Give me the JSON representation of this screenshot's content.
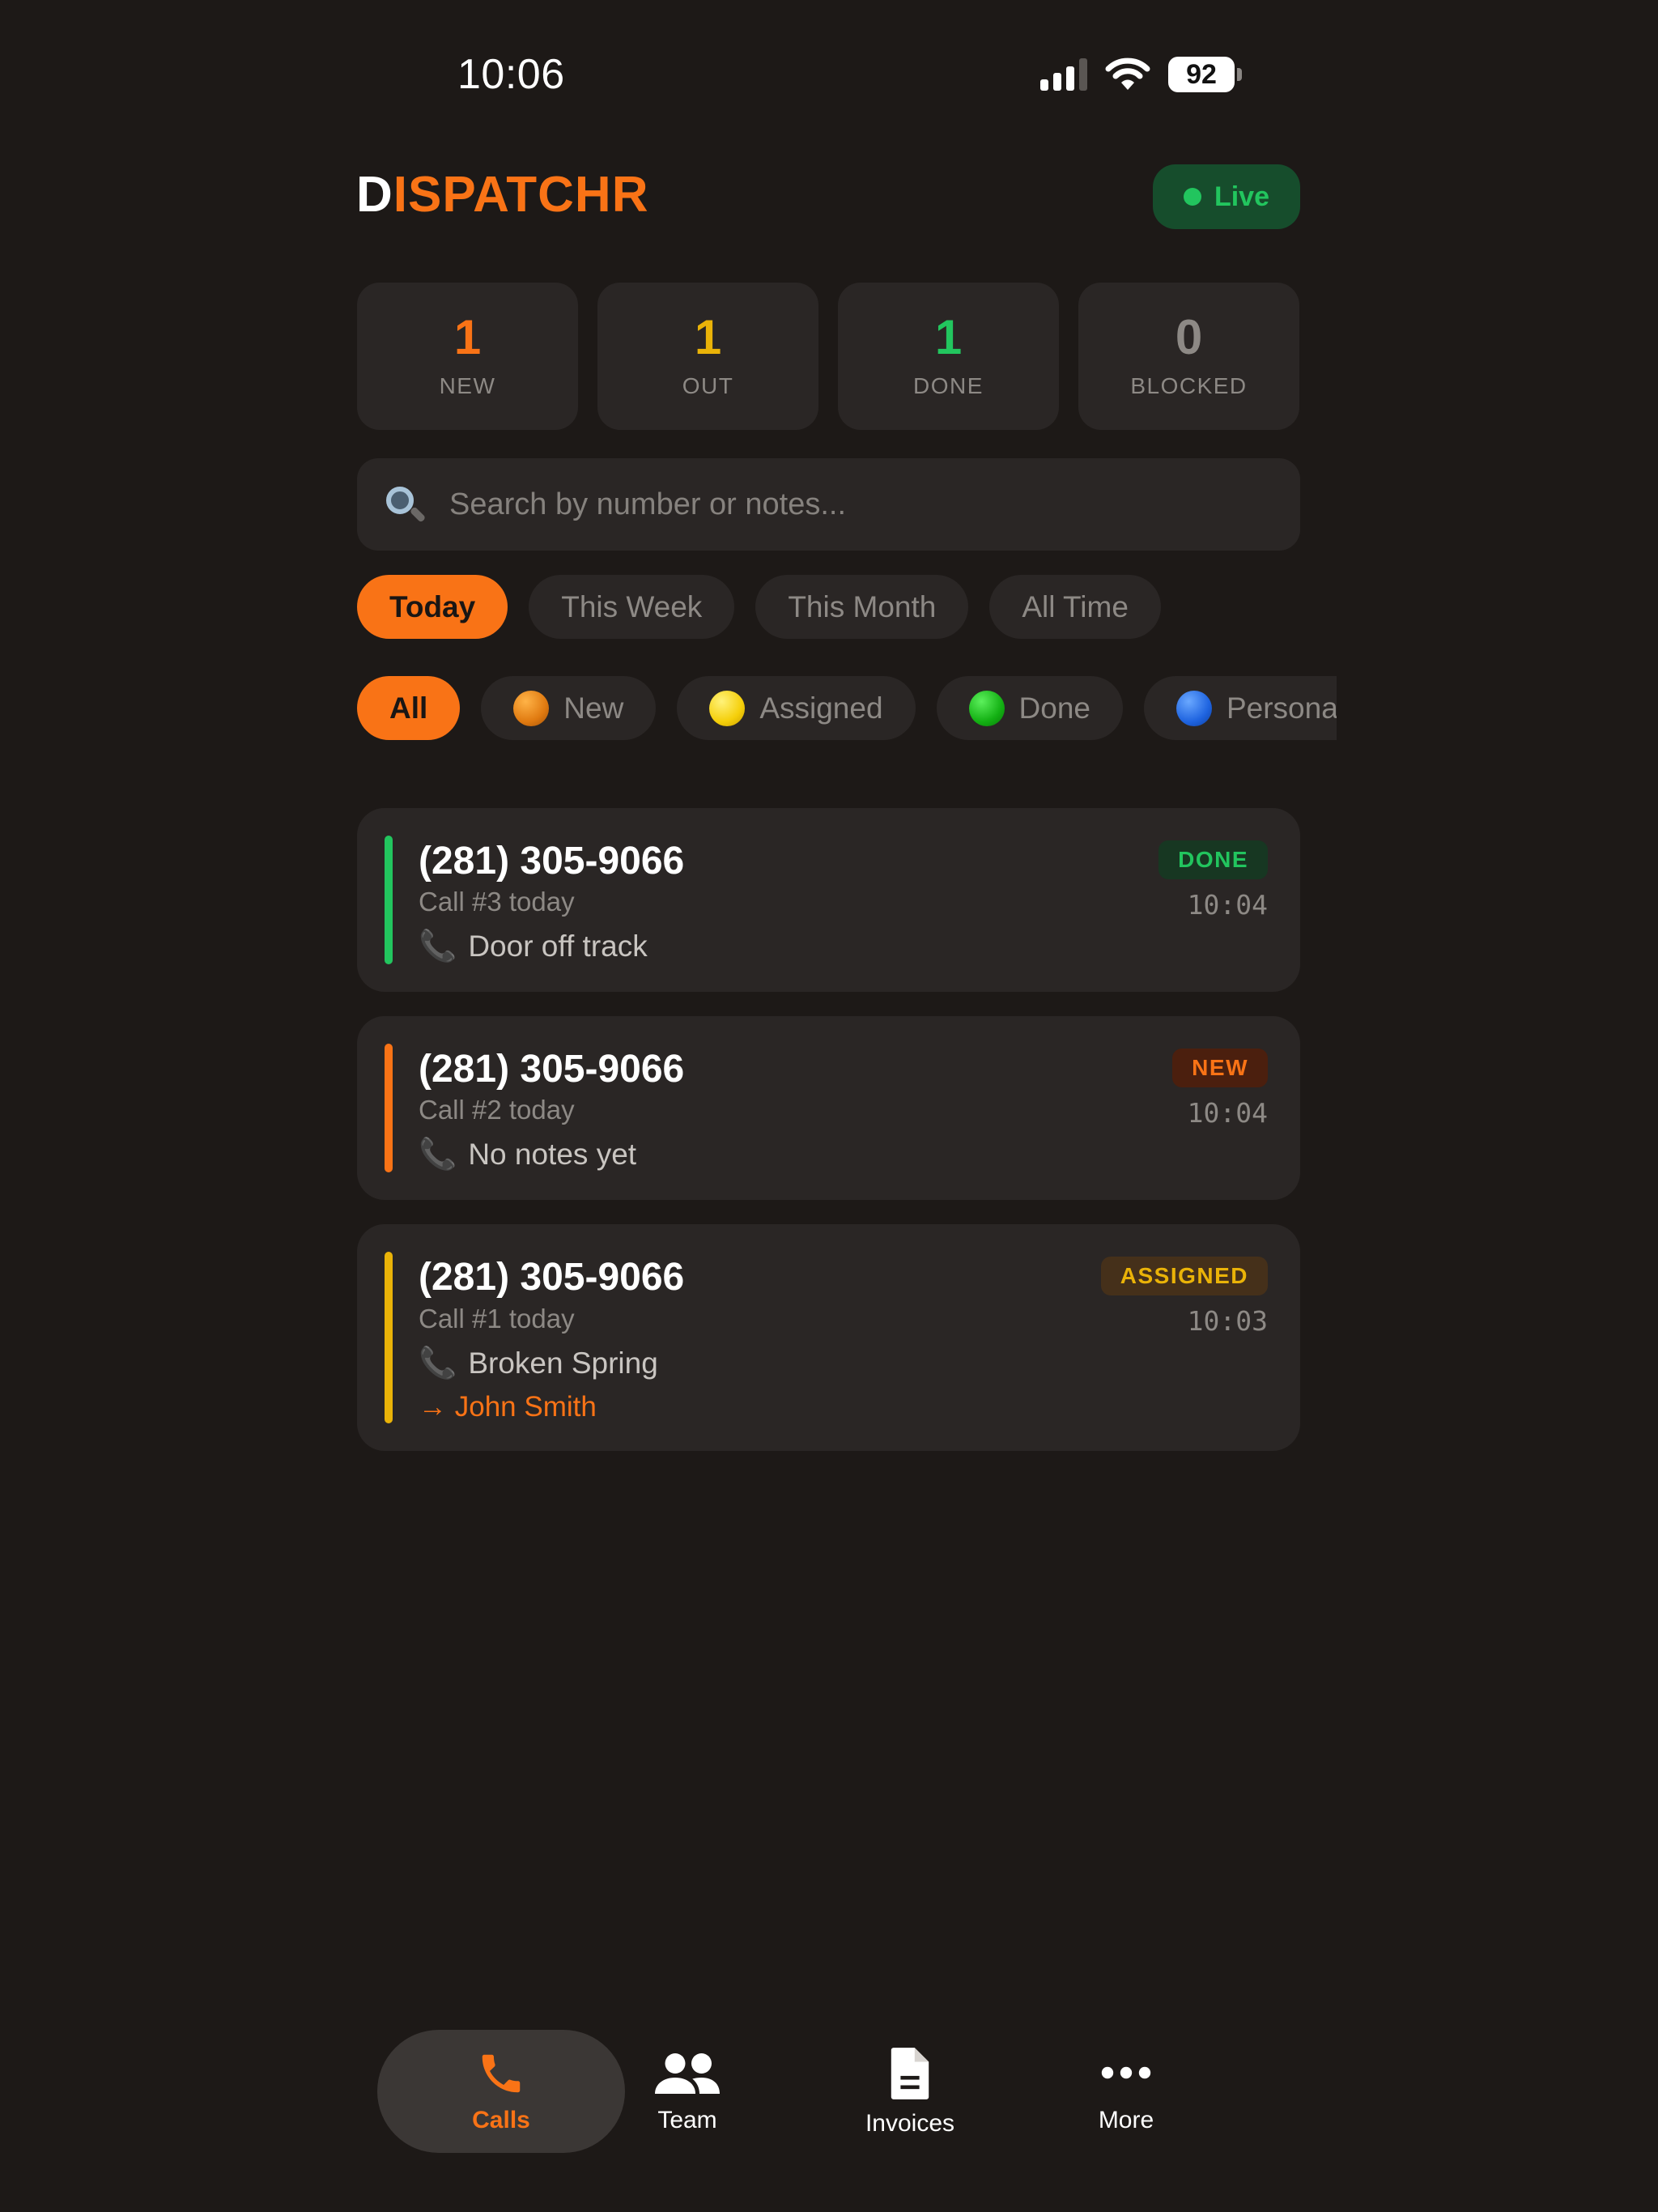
{
  "status_bar": {
    "time": "10:06",
    "battery": "92"
  },
  "header": {
    "brand_first": "D",
    "brand_rest": "ISPATCHR",
    "live_label": "Live"
  },
  "stats": [
    {
      "value": "1",
      "label": "NEW",
      "color": "#f97316"
    },
    {
      "value": "1",
      "label": "OUT",
      "color": "#eab308"
    },
    {
      "value": "1",
      "label": "DONE",
      "color": "#22c55e"
    },
    {
      "value": "0",
      "label": "BLOCKED",
      "color": "#8d8985"
    }
  ],
  "search": {
    "placeholder": "Search by number or notes...",
    "value": ""
  },
  "range_filters": [
    {
      "label": "Today",
      "active": true
    },
    {
      "label": "This Week",
      "active": false
    },
    {
      "label": "This Month",
      "active": false
    },
    {
      "label": "All Time",
      "active": false
    }
  ],
  "status_filters": [
    {
      "label": "All",
      "active": true
    },
    {
      "label": "New",
      "dot": "orange-circle-icon"
    },
    {
      "label": "Assigned",
      "dot": "yellow-circle-icon"
    },
    {
      "label": "Done",
      "dot": "green-circle-icon"
    },
    {
      "label": "Personal",
      "dot": "blue-circle-icon"
    }
  ],
  "calls": [
    {
      "number": "(281) 305-9066",
      "label": "Call #3 today",
      "notes": "Door off track",
      "status": "DONE",
      "time": "10:04",
      "assignee": "",
      "color": "#22c55e",
      "badge_bg": "#173722"
    },
    {
      "number": "(281) 305-9066",
      "label": "Call #2 today",
      "notes": "No notes yet",
      "status": "NEW",
      "time": "10:04",
      "assignee": "",
      "color": "#f97316",
      "badge_bg": "#4b1f0e"
    },
    {
      "number": "(281) 305-9066",
      "label": "Call #1 today",
      "notes": "Broken Spring",
      "status": "ASSIGNED",
      "time": "10:03",
      "assignee": "→ John Smith",
      "color": "#eab308",
      "badge_bg": "#45301a"
    }
  ],
  "tabs": [
    {
      "label": "Calls",
      "icon": "phone-icon",
      "active": true
    },
    {
      "label": "Team",
      "icon": "people-icon",
      "active": false
    },
    {
      "label": "Invoices",
      "icon": "document-icon",
      "active": false
    },
    {
      "label": "More",
      "icon": "more-dots-icon",
      "active": false
    }
  ]
}
